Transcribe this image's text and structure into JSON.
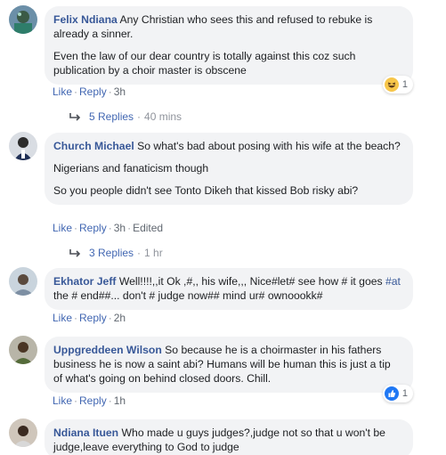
{
  "comments": [
    {
      "author": "Felix Ndiana",
      "text": "Any Christian who sees this and refused to rebuke is already a sinner.",
      "text2": "Even the law of our dear country is totally against this coz such publication by a choir master is obscene",
      "actions": {
        "like": "Like",
        "reply": "Reply",
        "time": "3h"
      },
      "reaction": {
        "icon": "haha-icon",
        "count": "1"
      },
      "replies": {
        "label": "5 Replies",
        "time": "40 mins"
      }
    },
    {
      "author": "Church Michael",
      "text": "So what's bad about posing with his wife at the beach?",
      "text2": "Nigerians and fanaticism though",
      "text3": "So you people didn't see Tonto Dikeh that kissed Bob risky abi?",
      "actions": {
        "like": "Like",
        "reply": "Reply",
        "time": "3h",
        "edited": "Edited"
      },
      "replies": {
        "label": "3 Replies",
        "time": "1 hr"
      }
    },
    {
      "author": "Ekhator Jeff",
      "text_a": "Well!!!!,,it Ok ,#,, his wife,,, Nice#let# see how # it goes ",
      "hashtag": "#at",
      "text_b": " the # end##... don't # judge now## mind ur# ownoookk#",
      "actions": {
        "like": "Like",
        "reply": "Reply",
        "time": "2h"
      }
    },
    {
      "author": "Uppgreddeen Wilson",
      "text": "So because he is a choirmaster in his fathers business he is now a saint abi? Humans will be human this is just a tip of what's going on behind closed doors. Chill.",
      "actions": {
        "like": "Like",
        "reply": "Reply",
        "time": "1h"
      },
      "reaction": {
        "icon": "like-icon",
        "count": "1"
      }
    },
    {
      "author": "Ndiana Ituen",
      "text": "Who made u guys judges?,judge not so that u won't be judge,leave everything to God to judge"
    }
  ],
  "separator": "·",
  "colors": {
    "link": "#385898",
    "bubble": "#f2f3f5",
    "action": "#4267b2"
  }
}
